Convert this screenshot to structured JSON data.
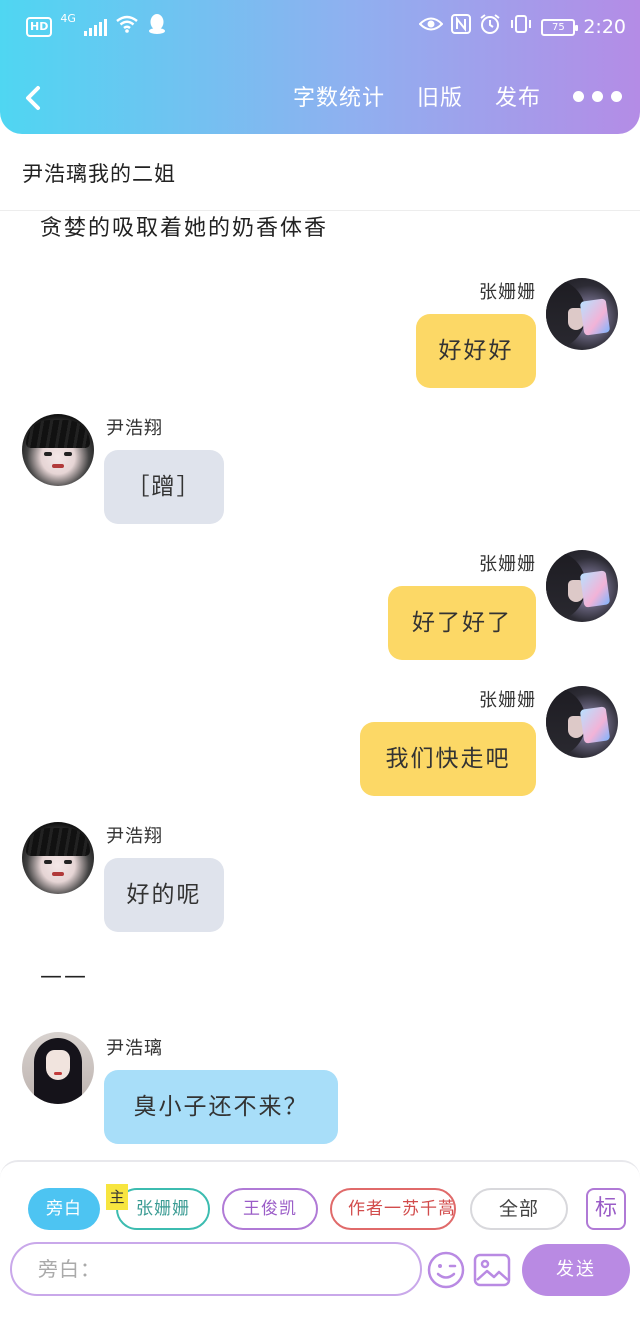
{
  "status_bar": {
    "hd": "HD",
    "network": "4G",
    "battery": "75",
    "time": "2:20"
  },
  "nav": {
    "word_count": "字数统计",
    "old_version": "旧版",
    "publish": "发布"
  },
  "story_title": "尹浩璃我的二姐",
  "narration_top": "贪婪的吸取着她的奶香体香",
  "narration_dash": "——",
  "messages": [
    {
      "side": "right",
      "sender": "张姗姗",
      "text": "好好好",
      "color": "yellow",
      "avatar": "zhang"
    },
    {
      "side": "left",
      "sender": "尹浩翔",
      "text": "［蹭］",
      "color": "grey",
      "avatar": "hao"
    },
    {
      "side": "right",
      "sender": "张姗姗",
      "text": "好了好了",
      "color": "yellow",
      "avatar": "zhang"
    },
    {
      "side": "right",
      "sender": "张姗姗",
      "text": "我们快走吧",
      "color": "yellow",
      "avatar": "zhang"
    },
    {
      "side": "left",
      "sender": "尹浩翔",
      "text": "好的呢",
      "color": "grey",
      "avatar": "hao"
    },
    {
      "side": "left",
      "sender": "尹浩璃",
      "text": "臭小子还不来？",
      "color": "blue",
      "avatar": "li"
    }
  ],
  "composer": {
    "chips": {
      "narrator": "旁白",
      "main_tag": "主",
      "zhang": "张姗姗",
      "wang": "王俊凯",
      "author": "作者一苏千蒿",
      "all": "全部"
    },
    "mark": "标",
    "input_placeholder": "旁白：",
    "send": "发送"
  },
  "colors": {
    "header_gradient_start": "#4fd6f2",
    "header_gradient_end": "#b48ce6",
    "bubble_yellow": "#fcd866",
    "bubble_grey": "#dfe3ec",
    "bubble_blue": "#a8def9",
    "send_button": "#b98ae3"
  }
}
